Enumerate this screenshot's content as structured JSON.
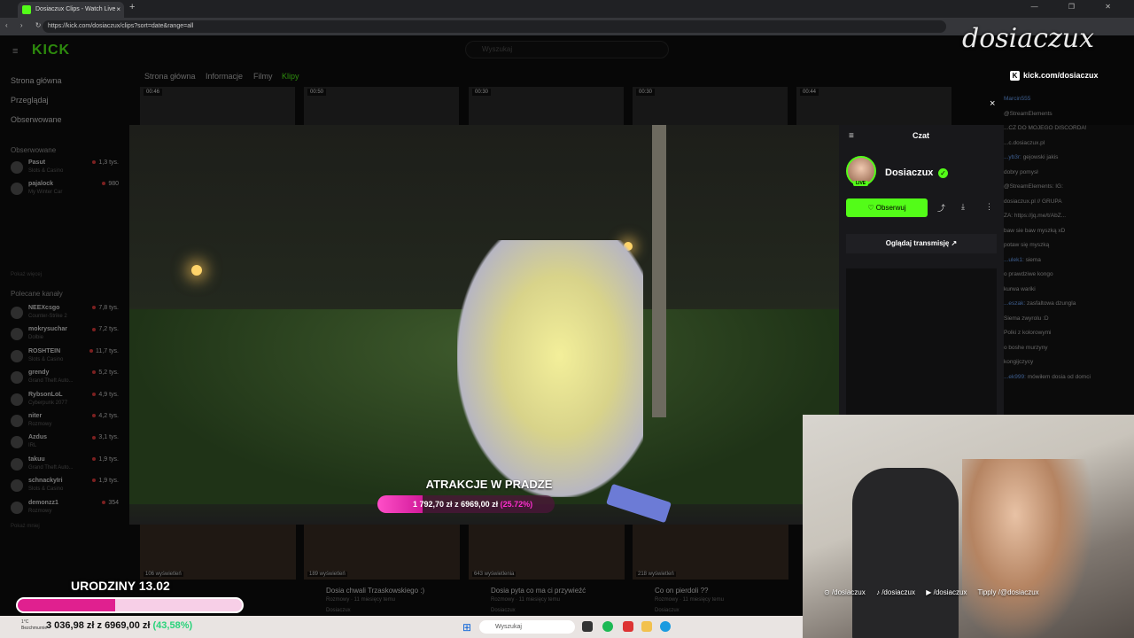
{
  "browser": {
    "tab_title": "Dosiaczux Clips - Watch Live",
    "url": "https://kick.com/dosiaczux/clips?sort=date&range=all",
    "new_tab": "+",
    "tab_close": "×",
    "window_controls": "— ❐ ✕",
    "nav": "‹ › ↻"
  },
  "kick": {
    "logo": "KICK",
    "search_placeholder": "Wyszukaj",
    "nav": {
      "home": "Strona główna",
      "browse": "Przeglądaj",
      "following": "Obserwowane"
    },
    "followed_heading": "Obserwowane",
    "followed": [
      {
        "name": "Pasut",
        "game": "Slots & Casino",
        "viewers": "1,3 tys."
      },
      {
        "name": "pajalock",
        "game": "My Winter Car",
        "viewers": "980"
      }
    ],
    "show_more": "Pokaż więcej",
    "recommended_heading": "Polecane kanały",
    "recommended": [
      {
        "name": "NEEXcsgo",
        "game": "Counter-Strike 2",
        "viewers": "7,8 tys."
      },
      {
        "name": "mokrysuchar",
        "game": "Dolbie",
        "viewers": "7,2 tys."
      },
      {
        "name": "ROSHTEIN",
        "game": "Slots & Casino",
        "viewers": "11,7 tys."
      },
      {
        "name": "grendy",
        "game": "Grand Theft Auto...",
        "viewers": "5,2 tys."
      },
      {
        "name": "RybsonLoL",
        "game": "Cyberpunk 2077",
        "viewers": "4,9 tys."
      },
      {
        "name": "niter",
        "game": "Rozmowy",
        "viewers": "4,2 tys."
      },
      {
        "name": "Azdus",
        "game": "IRL",
        "viewers": "3,1 tys."
      },
      {
        "name": "takuu",
        "game": "Grand Theft Auto...",
        "viewers": "1,9 tys."
      },
      {
        "name": "schnackyIri",
        "game": "Slots & Casino",
        "viewers": "1,9 tys."
      },
      {
        "name": "demonzz1",
        "game": "Rozmowy",
        "viewers": "354"
      }
    ],
    "show_less": "Pokaż mniej",
    "page_tabs": [
      "Strona główna",
      "Informacje",
      "Filmy",
      "Klipy"
    ],
    "top_thumbs": [
      "00:46",
      "00:50",
      "00:30",
      "00:30",
      "00:44"
    ],
    "bottom_clips": [
      {
        "views": "106 wyświetleń",
        "title": "",
        "sub": ""
      },
      {
        "views": "189 wyświetleń",
        "title": "Dosia chwali Trzaskowskiego :)",
        "sub": "Rozmowy · 11 miesięcy temu"
      },
      {
        "views": "643 wyświetlenia",
        "title": "Dosia pyta co ma ci przywieźć",
        "sub": "Rozmowy · 11 miesięcy temu"
      },
      {
        "views": "218 wyświetleń",
        "title": "Co on pierdoli ??",
        "sub": "Rozmowy · 11 miesięcy temu"
      }
    ],
    "clip_author": "Dosiaczux"
  },
  "video": {
    "goal_title": "ATRAKCJE W PRADZE",
    "goal_current": "1 792,70 zł",
    "goal_sep": "z",
    "goal_target": "6969,00 zł",
    "goal_pct": "(25.72%)",
    "goal_fraction": 0.2572
  },
  "panel": {
    "menu_icon": "≡",
    "title": "Czat",
    "streamer": "Dosiaczux",
    "live_badge": "LIVE",
    "verified": "✓",
    "follow": "♡ Obserwuj",
    "share_icon": "⤴",
    "download_icon": "⤓",
    "more_icon": "⋮",
    "watch_stream": "Oglądaj transmisję ↗",
    "close": "×"
  },
  "chat": {
    "lines": [
      {
        "user": "Marcin555",
        "text": ""
      },
      {
        "user": "",
        "text": "@StreamElements"
      },
      {
        "user": "",
        "text": "...CZ DO MOJEGO DISCORDA!"
      },
      {
        "user": "",
        "text": "...c.dosiaczux.pl"
      },
      {
        "user": "...yb3r:",
        "text": "gejowski jakis"
      },
      {
        "user": "",
        "text": "dobry pomysł"
      },
      {
        "user": "",
        "text": "@StreamElements: IG:"
      },
      {
        "user": "",
        "text": "dosiaczux.pl // GRUPA"
      },
      {
        "user": "",
        "text": "ZA: https://jq.me/t/AbZ..."
      },
      {
        "user": "",
        "text": "baw sie baw myszką xD"
      },
      {
        "user": "",
        "text": "potaw się myszką"
      },
      {
        "user": "...ulek1:",
        "text": "siema"
      },
      {
        "user": "",
        "text": "o prawdziwe kongo"
      },
      {
        "user": "",
        "text": "kurwa wariki"
      },
      {
        "user": "...eszak:",
        "text": "zasfaltowa dzungla"
      },
      {
        "user": "",
        "text": "Siema zwyrolu :D"
      },
      {
        "user": "",
        "text": "Polki z kolorowymi"
      },
      {
        "user": "",
        "text": "o boshe murzyny"
      },
      {
        "user": "",
        "text": "kongijczycy"
      },
      {
        "user": "...ek999:",
        "text": "mówiłem dosia od domci"
      }
    ]
  },
  "overlay": {
    "brand": "dosiaczux",
    "brand_url": "kick.com/dosiaczux",
    "socials": [
      "⊙ /dosiaczux",
      "♪ /dosiaczux",
      "▶ /dosiaczux",
      "Tipply /@dosiaczux"
    ],
    "bday_title": "URODZINY 13.02",
    "bday_fraction": 0.4358
  },
  "taskbar": {
    "weather_temp": "1°C",
    "weather_desc": "Bezchmurnie",
    "money_current": "3 036,98 zł",
    "money_sep": "z",
    "money_target": "6969,00 zł",
    "money_pct": "(43,58%)",
    "search": "Wyszukaj",
    "start": "⊞"
  },
  "colors": {
    "kick_green": "#53fc18",
    "goal_pink": "#e0208f"
  }
}
